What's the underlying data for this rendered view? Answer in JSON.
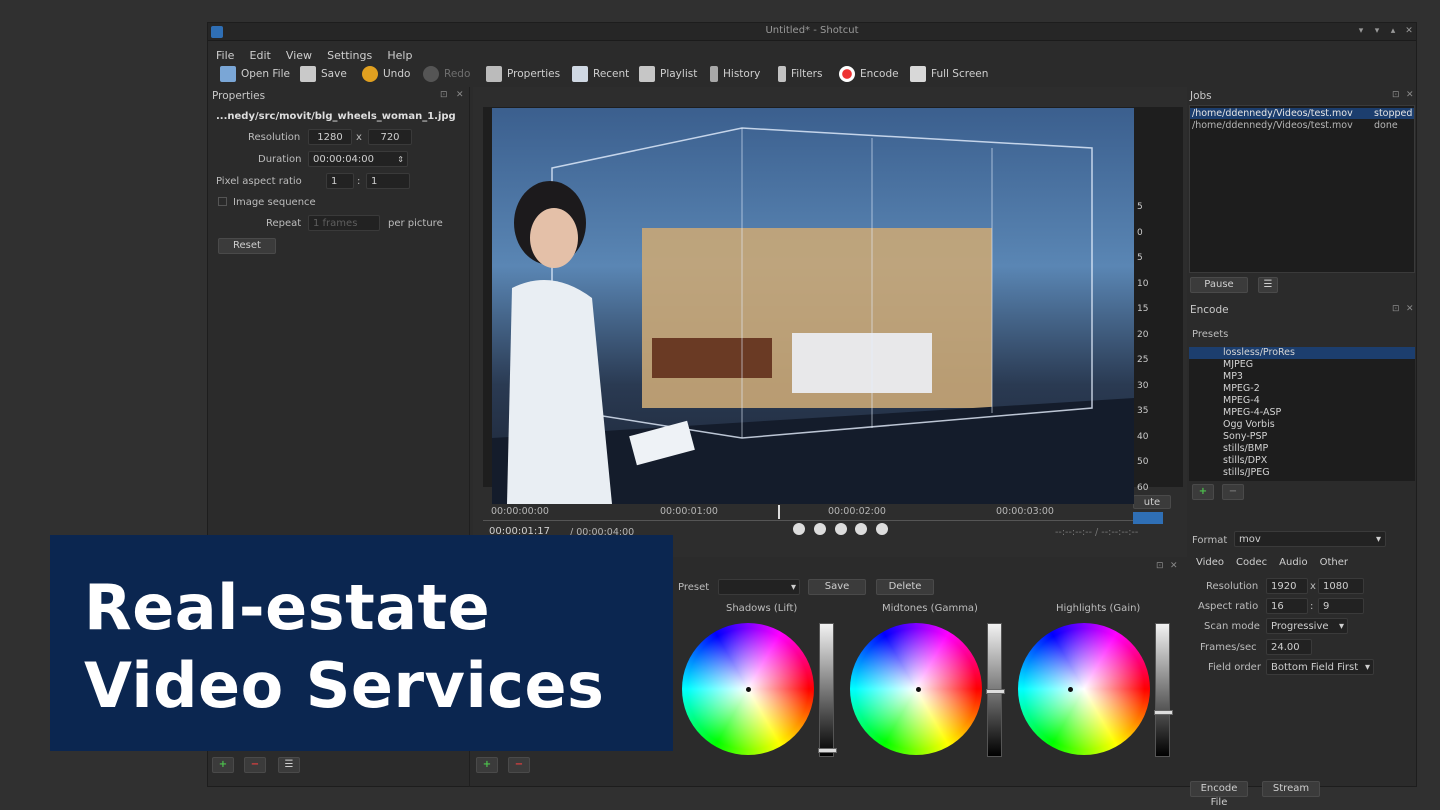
{
  "window": {
    "title": "Untitled* - Shotcut"
  },
  "menu": [
    "File",
    "Edit",
    "View",
    "Settings",
    "Help"
  ],
  "toolbar": {
    "open": "Open File",
    "save": "Save",
    "undo": "Undo",
    "redo": "Redo",
    "properties": "Properties",
    "recent": "Recent",
    "playlist": "Playlist",
    "history": "History",
    "filters": "Filters",
    "encode": "Encode",
    "fullscreen": "Full Screen"
  },
  "properties": {
    "title": "Properties",
    "file": "...nedy/src/movit/blg_wheels_woman_1.jpg",
    "resolution_label": "Resolution",
    "res_w": "1280",
    "res_x": "x",
    "res_h": "720",
    "duration_label": "Duration",
    "duration": "00:00:04:00",
    "par_label": "Pixel aspect ratio",
    "par_a": "1",
    "par_sep": ":",
    "par_b": "1",
    "imgseq_label": "Image sequence",
    "repeat_label": "Repeat",
    "repeat_value": "1 frames",
    "per_picture": "per picture",
    "reset": "Reset"
  },
  "player": {
    "ticks": [
      "00:00:00:00",
      "00:00:01:00",
      "00:00:02:00",
      "00:00:03:00"
    ],
    "position": "00:00:01:17",
    "duration": "/ 00:00:04:00",
    "inout": "--:--:--:-- / --:--:--:--",
    "meter": [
      "5",
      "0",
      "5",
      "10",
      "15",
      "20",
      "25",
      "30",
      "35",
      "40",
      "50",
      "60"
    ],
    "mute": "ute"
  },
  "jobs": {
    "title": "Jobs",
    "rows": [
      {
        "path": "/home/ddennedy/Videos/test.mov",
        "status": "stopped"
      },
      {
        "path": "/home/ddennedy/Videos/test.mov",
        "status": "done"
      }
    ],
    "pause": "Pause"
  },
  "encode": {
    "title": "Encode",
    "presets_label": "Presets",
    "presets": [
      "lossless/ProRes",
      "MJPEG",
      "MP3",
      "MPEG-2",
      "MPEG-4",
      "MPEG-4-ASP",
      "Ogg Vorbis",
      "Sony-PSP",
      "stills/BMP",
      "stills/DPX",
      "stills/JPEG"
    ],
    "format_label": "Format",
    "format": "mov",
    "tabs": [
      "Video",
      "Codec",
      "Audio",
      "Other"
    ],
    "resolution_label": "Resolution",
    "res_w": "1920",
    "res_x": "x",
    "res_h": "1080",
    "aspect_label": "Aspect ratio",
    "aspect_a": "16",
    "aspect_sep": ":",
    "aspect_b": "9",
    "scan_label": "Scan mode",
    "scan": "Progressive",
    "fps_label": "Frames/sec",
    "fps": "24.00",
    "field_label": "Field order",
    "field": "Bottom Field First",
    "encode_file": "Encode File",
    "stream": "Stream"
  },
  "color": {
    "preset_label": "Preset",
    "save": "Save",
    "delete": "Delete",
    "shadows": "Shadows (Lift)",
    "midtones": "Midtones (Gamma)",
    "highlights": "Highlights (Gain)"
  },
  "banner": {
    "line1": "Real-estate",
    "line2": "Video Services",
    "bg": "#0b2650"
  }
}
